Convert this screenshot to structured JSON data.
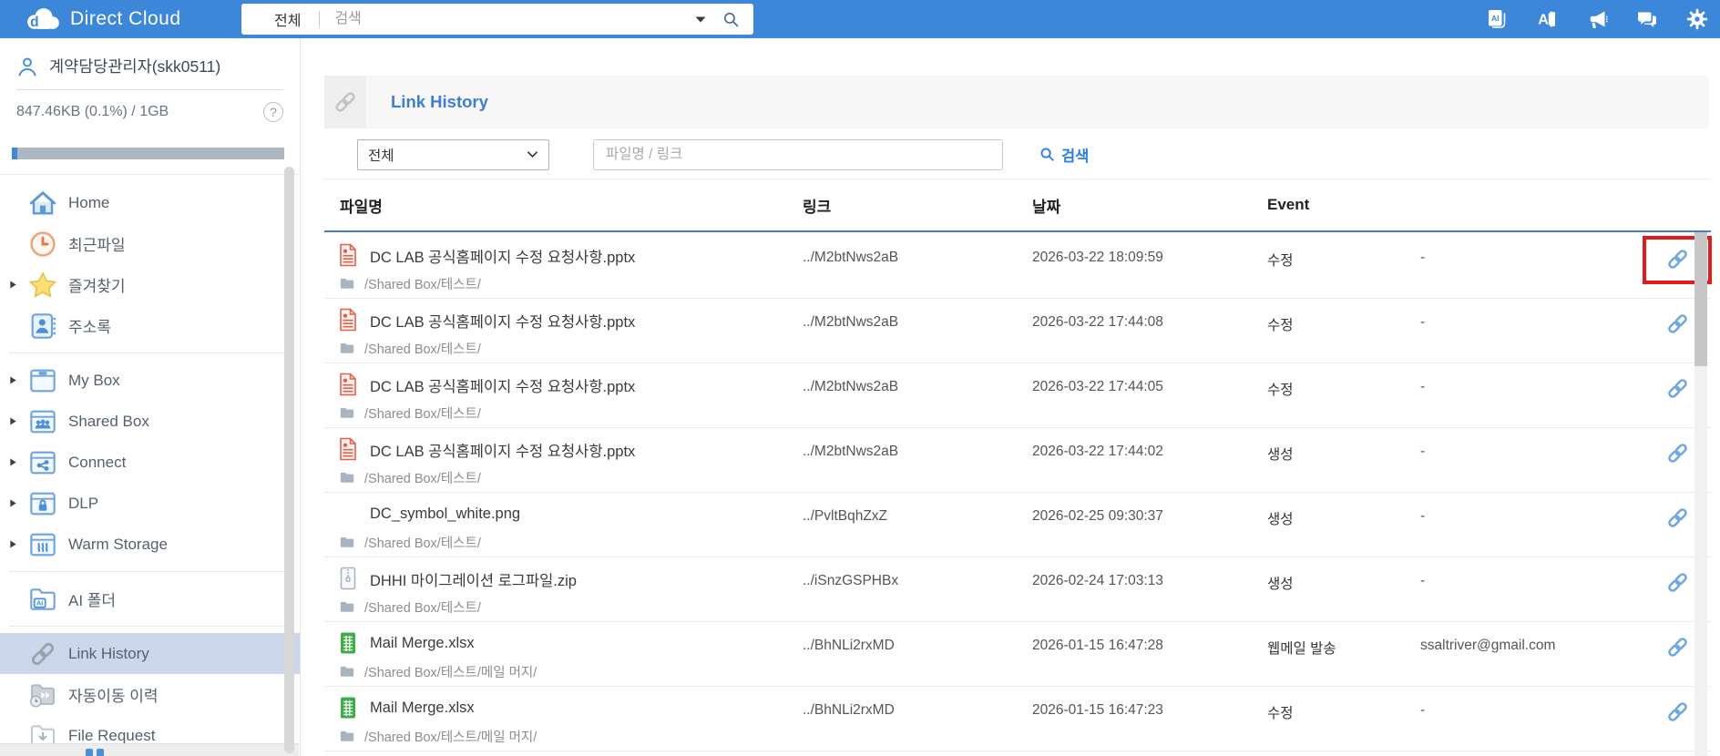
{
  "header": {
    "brand": "Direct Cloud",
    "search": {
      "scope": "전체",
      "placeholder": "검색"
    },
    "icons": [
      {
        "name": "ai-docs-icon"
      },
      {
        "name": "ai-translate-icon"
      },
      {
        "name": "megaphone-icon"
      },
      {
        "name": "chat-icon"
      },
      {
        "name": "gear-icon"
      }
    ]
  },
  "sidebar": {
    "user_name": "계약담당관리자(skk0511)",
    "storage_text": "847.46KB (0.1%) / 1GB",
    "storage_percent": 0.1,
    "help_label": "?",
    "nav_groups": [
      {
        "items": [
          {
            "icon": "home-icon",
            "label": "Home"
          },
          {
            "icon": "recent-files-icon",
            "label": "최근파일"
          },
          {
            "icon": "star-icon",
            "label": "즐겨찾기",
            "expandable": true
          },
          {
            "icon": "addressbook-icon",
            "label": "주소록"
          }
        ]
      },
      {
        "items": [
          {
            "icon": "mybox-icon",
            "label": "My Box",
            "expandable": true
          },
          {
            "icon": "sharedbox-icon",
            "label": "Shared Box",
            "expandable": true
          },
          {
            "icon": "connect-icon",
            "label": "Connect",
            "expandable": true
          },
          {
            "icon": "dlp-icon",
            "label": "DLP",
            "expandable": true
          },
          {
            "icon": "warm-storage-icon",
            "label": "Warm Storage",
            "expandable": true
          }
        ]
      },
      {
        "items": [
          {
            "icon": "ai-folder-icon",
            "label": "AI 폴더"
          }
        ]
      },
      {
        "items": [
          {
            "icon": "link-icon",
            "label": "Link History",
            "selected": true
          },
          {
            "icon": "auto-move-icon",
            "label": "자동이동 이력"
          },
          {
            "icon": "file-request-icon",
            "label": "File Request"
          }
        ]
      }
    ]
  },
  "main": {
    "title": "Link History",
    "filter": {
      "scope": "전체",
      "input_placeholder": "파일명 / 링크",
      "search_label": "검색"
    },
    "table": {
      "columns": [
        "파일명",
        "링크",
        "날짜",
        "Event"
      ],
      "rows": [
        {
          "file_icon": "pptx-file-icon",
          "name": "DC LAB 공식홈페이지 수정 요청사항.pptx",
          "path": "/Shared Box/테스트/",
          "link": "../M2btNws2aB",
          "date": "2026-03-22 18:09:59",
          "event": "수정",
          "recipient": "-",
          "highlighted": true
        },
        {
          "file_icon": "pptx-file-icon",
          "name": "DC LAB 공식홈페이지 수정 요청사항.pptx",
          "path": "/Shared Box/테스트/",
          "link": "../M2btNws2aB",
          "date": "2026-03-22 17:44:08",
          "event": "수정",
          "recipient": "-"
        },
        {
          "file_icon": "pptx-file-icon",
          "name": "DC LAB 공식홈페이지 수정 요청사항.pptx",
          "path": "/Shared Box/테스트/",
          "link": "../M2btNws2aB",
          "date": "2026-03-22 17:44:05",
          "event": "수정",
          "recipient": "-"
        },
        {
          "file_icon": "pptx-file-icon",
          "name": "DC LAB 공식홈페이지 수정 요청사항.pptx",
          "path": "/Shared Box/테스트/",
          "link": "../M2btNws2aB",
          "date": "2026-03-22 17:44:02",
          "event": "생성",
          "recipient": "-"
        },
        {
          "file_icon": "none",
          "name": "DC_symbol_white.png",
          "path": "/Shared Box/테스트/",
          "link": "../PvltBqhZxZ",
          "date": "2026-02-25 09:30:37",
          "event": "생성",
          "recipient": "-"
        },
        {
          "file_icon": "zip-file-icon",
          "name": "DHHI 마이그레이션 로그파일.zip",
          "path": "/Shared Box/테스트/",
          "link": "../iSnzGSPHBx",
          "date": "2026-02-24 17:03:13",
          "event": "생성",
          "recipient": "-"
        },
        {
          "file_icon": "xlsx-file-icon",
          "name": "Mail Merge.xlsx",
          "path": "/Shared Box/테스트/메일 머지/",
          "link": "../BhNLi2rxMD",
          "date": "2026-01-15 16:47:28",
          "event": "웹메일 발송",
          "recipient": "ssaltriver@gmail.com"
        },
        {
          "file_icon": "xlsx-file-icon",
          "name": "Mail Merge.xlsx",
          "path": "/Shared Box/테스트/메일 머지/",
          "link": "../BhNLi2rxMD",
          "date": "2026-01-15 16:47:23",
          "event": "수정",
          "recipient": "-"
        }
      ]
    }
  }
}
